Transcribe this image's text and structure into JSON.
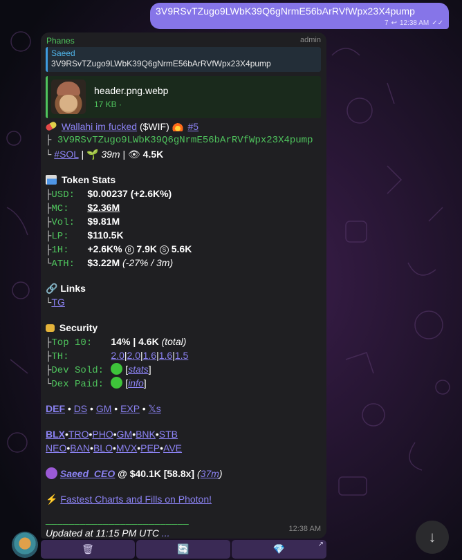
{
  "outgoing": {
    "text": "3V9RSvTZugo9LWbK39Q6gNrmE56bArRVfWpx23X4pump",
    "replies": "7",
    "time": "12:38 AM"
  },
  "message": {
    "sender": "Phanes",
    "role": "admin",
    "time": "12:38 AM",
    "quote": {
      "name": "Saeed",
      "text": "3V9RSvTZugo9LWbK39Q6gNrmE56bArRVfWpx23X4pump"
    },
    "file": {
      "name": "header.png.webp",
      "size": "17 KB ·"
    },
    "token": {
      "name_link": "Wallahi im fucked",
      "ticker": "($WIF)",
      "rank": "#5",
      "contract": "3V9RSvTZugo9LWbK39Q6gNrmE56bArRVfWpx23X4pump",
      "chain": "#SOL",
      "age": "39m",
      "views": "4.5K"
    },
    "stats": {
      "title": "Token Stats",
      "usd_label": "USD:",
      "usd": "$0.00237 (+2.6K%)",
      "mc_label": "MC:",
      "mc": "$2.36M",
      "vol_label": "Vol:",
      "vol": "$9.81M",
      "lp_label": "LP:",
      "lp": "$110.5K",
      "h1_label": "1H:",
      "h1_change": "+2.6K%",
      "h1_buys": "7.9K",
      "h1_sells": "5.6K",
      "ath_label": "ATH:",
      "ath": "$3.22M",
      "ath_note": "(-27% / 3m)"
    },
    "links": {
      "title": "Links",
      "tg": "TG"
    },
    "security": {
      "title": "Security",
      "top10_label": "Top 10:",
      "top10": "14% | 4.6K",
      "top10_note": "(total)",
      "th_label": "TH:",
      "th": [
        "2.0",
        "2.0",
        "1.6",
        "1.6",
        "1.5"
      ],
      "dev_sold_label": "Dev Sold:",
      "dev_sold_link": "stats",
      "dex_paid_label": "Dex Paid:",
      "dex_paid_link": "info"
    },
    "quick_links": [
      "DEF",
      "DS",
      "GM",
      "EXP",
      "𝕏s"
    ],
    "bots_row1": [
      "BLX",
      "TRO",
      "PHO",
      "GM",
      "BNK",
      "STB"
    ],
    "bots_row2": [
      "NEO",
      "BAN",
      "BLO",
      "MVX",
      "PEP",
      "AVE"
    ],
    "caller": {
      "name": "Saeed_CEO",
      "at": "@ $40.1K [58.8x]",
      "ago": "37m"
    },
    "promo": "Fastest Charts and Fills on Photon!",
    "divider": "_________________________",
    "updated": "Updated at 11:15 PM UTC",
    "updated_more": "..."
  },
  "buttons": [
    {
      "icon": "trash-icon",
      "glyph": "🗑"
    },
    {
      "icon": "refresh-icon",
      "glyph": "🔄"
    },
    {
      "icon": "diamond-icon",
      "glyph": "💎",
      "corner": "↗"
    }
  ]
}
